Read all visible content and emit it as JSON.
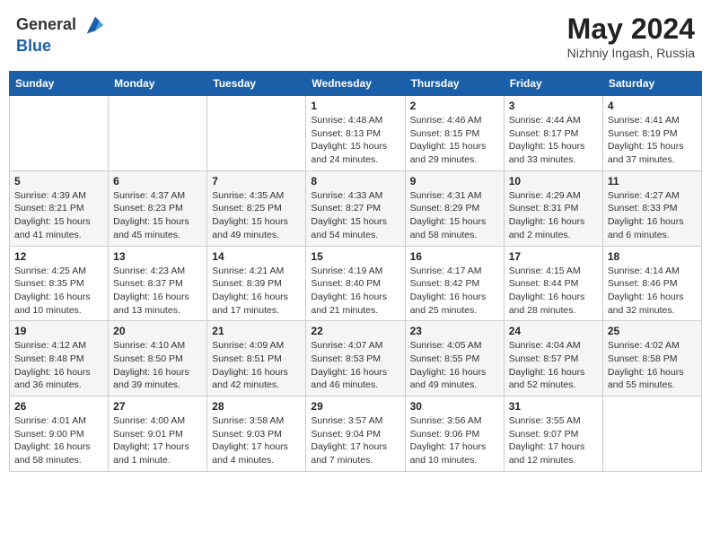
{
  "header": {
    "logo": {
      "line1": "General",
      "line2": "Blue"
    },
    "month_year": "May 2024",
    "location": "Nizhniy Ingash, Russia"
  },
  "days_of_week": [
    "Sunday",
    "Monday",
    "Tuesday",
    "Wednesday",
    "Thursday",
    "Friday",
    "Saturday"
  ],
  "weeks": [
    [
      null,
      null,
      null,
      {
        "day": "1",
        "sunrise": "4:48 AM",
        "sunset": "8:13 PM",
        "daylight": "15 hours and 24 minutes."
      },
      {
        "day": "2",
        "sunrise": "4:46 AM",
        "sunset": "8:15 PM",
        "daylight": "15 hours and 29 minutes."
      },
      {
        "day": "3",
        "sunrise": "4:44 AM",
        "sunset": "8:17 PM",
        "daylight": "15 hours and 33 minutes."
      },
      {
        "day": "4",
        "sunrise": "4:41 AM",
        "sunset": "8:19 PM",
        "daylight": "15 hours and 37 minutes."
      }
    ],
    [
      {
        "day": "5",
        "sunrise": "4:39 AM",
        "sunset": "8:21 PM",
        "daylight": "15 hours and 41 minutes."
      },
      {
        "day": "6",
        "sunrise": "4:37 AM",
        "sunset": "8:23 PM",
        "daylight": "15 hours and 45 minutes."
      },
      {
        "day": "7",
        "sunrise": "4:35 AM",
        "sunset": "8:25 PM",
        "daylight": "15 hours and 49 minutes."
      },
      {
        "day": "8",
        "sunrise": "4:33 AM",
        "sunset": "8:27 PM",
        "daylight": "15 hours and 54 minutes."
      },
      {
        "day": "9",
        "sunrise": "4:31 AM",
        "sunset": "8:29 PM",
        "daylight": "15 hours and 58 minutes."
      },
      {
        "day": "10",
        "sunrise": "4:29 AM",
        "sunset": "8:31 PM",
        "daylight": "16 hours and 2 minutes."
      },
      {
        "day": "11",
        "sunrise": "4:27 AM",
        "sunset": "8:33 PM",
        "daylight": "16 hours and 6 minutes."
      }
    ],
    [
      {
        "day": "12",
        "sunrise": "4:25 AM",
        "sunset": "8:35 PM",
        "daylight": "16 hours and 10 minutes."
      },
      {
        "day": "13",
        "sunrise": "4:23 AM",
        "sunset": "8:37 PM",
        "daylight": "16 hours and 13 minutes."
      },
      {
        "day": "14",
        "sunrise": "4:21 AM",
        "sunset": "8:39 PM",
        "daylight": "16 hours and 17 minutes."
      },
      {
        "day": "15",
        "sunrise": "4:19 AM",
        "sunset": "8:40 PM",
        "daylight": "16 hours and 21 minutes."
      },
      {
        "day": "16",
        "sunrise": "4:17 AM",
        "sunset": "8:42 PM",
        "daylight": "16 hours and 25 minutes."
      },
      {
        "day": "17",
        "sunrise": "4:15 AM",
        "sunset": "8:44 PM",
        "daylight": "16 hours and 28 minutes."
      },
      {
        "day": "18",
        "sunrise": "4:14 AM",
        "sunset": "8:46 PM",
        "daylight": "16 hours and 32 minutes."
      }
    ],
    [
      {
        "day": "19",
        "sunrise": "4:12 AM",
        "sunset": "8:48 PM",
        "daylight": "16 hours and 36 minutes."
      },
      {
        "day": "20",
        "sunrise": "4:10 AM",
        "sunset": "8:50 PM",
        "daylight": "16 hours and 39 minutes."
      },
      {
        "day": "21",
        "sunrise": "4:09 AM",
        "sunset": "8:51 PM",
        "daylight": "16 hours and 42 minutes."
      },
      {
        "day": "22",
        "sunrise": "4:07 AM",
        "sunset": "8:53 PM",
        "daylight": "16 hours and 46 minutes."
      },
      {
        "day": "23",
        "sunrise": "4:05 AM",
        "sunset": "8:55 PM",
        "daylight": "16 hours and 49 minutes."
      },
      {
        "day": "24",
        "sunrise": "4:04 AM",
        "sunset": "8:57 PM",
        "daylight": "16 hours and 52 minutes."
      },
      {
        "day": "25",
        "sunrise": "4:02 AM",
        "sunset": "8:58 PM",
        "daylight": "16 hours and 55 minutes."
      }
    ],
    [
      {
        "day": "26",
        "sunrise": "4:01 AM",
        "sunset": "9:00 PM",
        "daylight": "16 hours and 58 minutes."
      },
      {
        "day": "27",
        "sunrise": "4:00 AM",
        "sunset": "9:01 PM",
        "daylight": "17 hours and 1 minute."
      },
      {
        "day": "28",
        "sunrise": "3:58 AM",
        "sunset": "9:03 PM",
        "daylight": "17 hours and 4 minutes."
      },
      {
        "day": "29",
        "sunrise": "3:57 AM",
        "sunset": "9:04 PM",
        "daylight": "17 hours and 7 minutes."
      },
      {
        "day": "30",
        "sunrise": "3:56 AM",
        "sunset": "9:06 PM",
        "daylight": "17 hours and 10 minutes."
      },
      {
        "day": "31",
        "sunrise": "3:55 AM",
        "sunset": "9:07 PM",
        "daylight": "17 hours and 12 minutes."
      },
      null
    ]
  ]
}
